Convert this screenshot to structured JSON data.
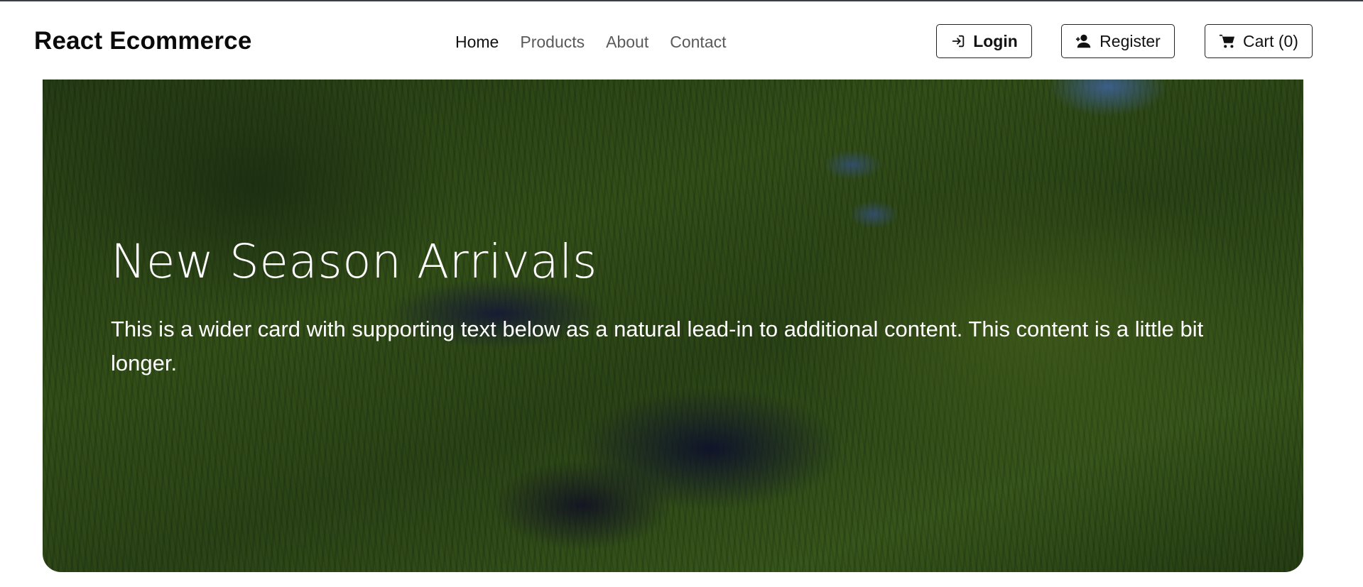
{
  "brand": {
    "name": "React Ecommerce"
  },
  "nav": {
    "links": [
      {
        "label": "Home",
        "active": true
      },
      {
        "label": "Products",
        "active": false
      },
      {
        "label": "About",
        "active": false
      },
      {
        "label": "Contact",
        "active": false
      }
    ]
  },
  "actions": {
    "login": {
      "label": "Login",
      "icon": "sign-in-icon"
    },
    "register": {
      "label": "Register",
      "icon": "user-plus-icon"
    },
    "cart": {
      "label": "Cart (0)",
      "icon": "shopping-cart-icon"
    }
  },
  "hero": {
    "title": "New Season Arrivals",
    "text": "This is a wider card with supporting text below as a natural lead-in to additional content. This content is a little bit longer.",
    "image": "aerial-forest-river-photo"
  },
  "colors": {
    "text_dark": "#111111",
    "nav_muted": "#5a5a5a",
    "hero_text": "#ffffff"
  }
}
